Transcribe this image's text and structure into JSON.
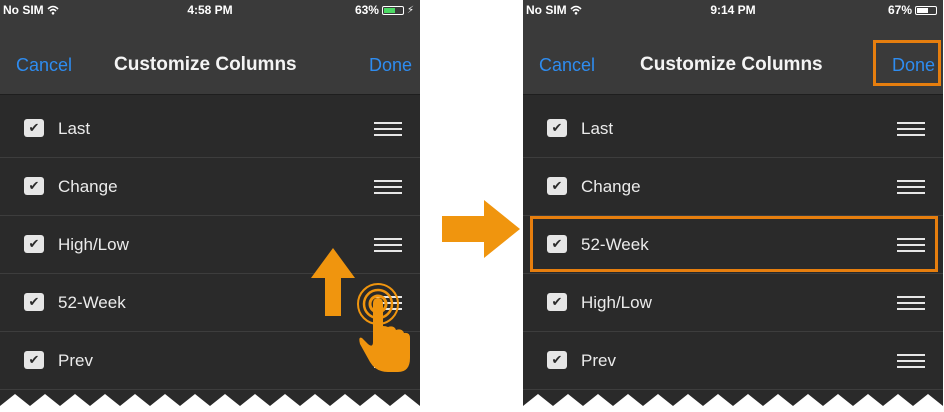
{
  "left_screen": {
    "status": {
      "carrier": "No SIM",
      "time": "4:58 PM",
      "battery": "63%",
      "battery_level": 0.63
    },
    "nav": {
      "cancel": "Cancel",
      "title": "Customize Columns",
      "done": "Done"
    },
    "columns": [
      {
        "label": "Last",
        "checked": true
      },
      {
        "label": "Change",
        "checked": true
      },
      {
        "label": "High/Low",
        "checked": true
      },
      {
        "label": "52-Week",
        "checked": true
      },
      {
        "label": "Prev",
        "checked": true
      }
    ]
  },
  "right_screen": {
    "status": {
      "carrier": "No SIM",
      "time": "9:14 PM",
      "battery": "67%",
      "battery_level": 0.67
    },
    "nav": {
      "cancel": "Cancel",
      "title": "Customize Columns",
      "done": "Done"
    },
    "columns": [
      {
        "label": "Last",
        "checked": true
      },
      {
        "label": "Change",
        "checked": true
      },
      {
        "label": "52-Week",
        "checked": true
      },
      {
        "label": "High/Low",
        "checked": true
      },
      {
        "label": "Prev",
        "checked": true
      }
    ]
  },
  "icons": {
    "wifi": "wifi-icon",
    "battery": "battery-icon",
    "checkbox": "checkmark-icon",
    "reorder": "drag-handle-icon",
    "drag_arrow": "up-arrow-icon",
    "touch": "tap-hand-icon",
    "flow_arrow": "right-arrow-icon"
  },
  "colors": {
    "accent": "#2e8cf0",
    "highlight": "#e67e0e",
    "screen_bg": "#2a2a2a",
    "bar_bg": "#3a3a3a"
  }
}
